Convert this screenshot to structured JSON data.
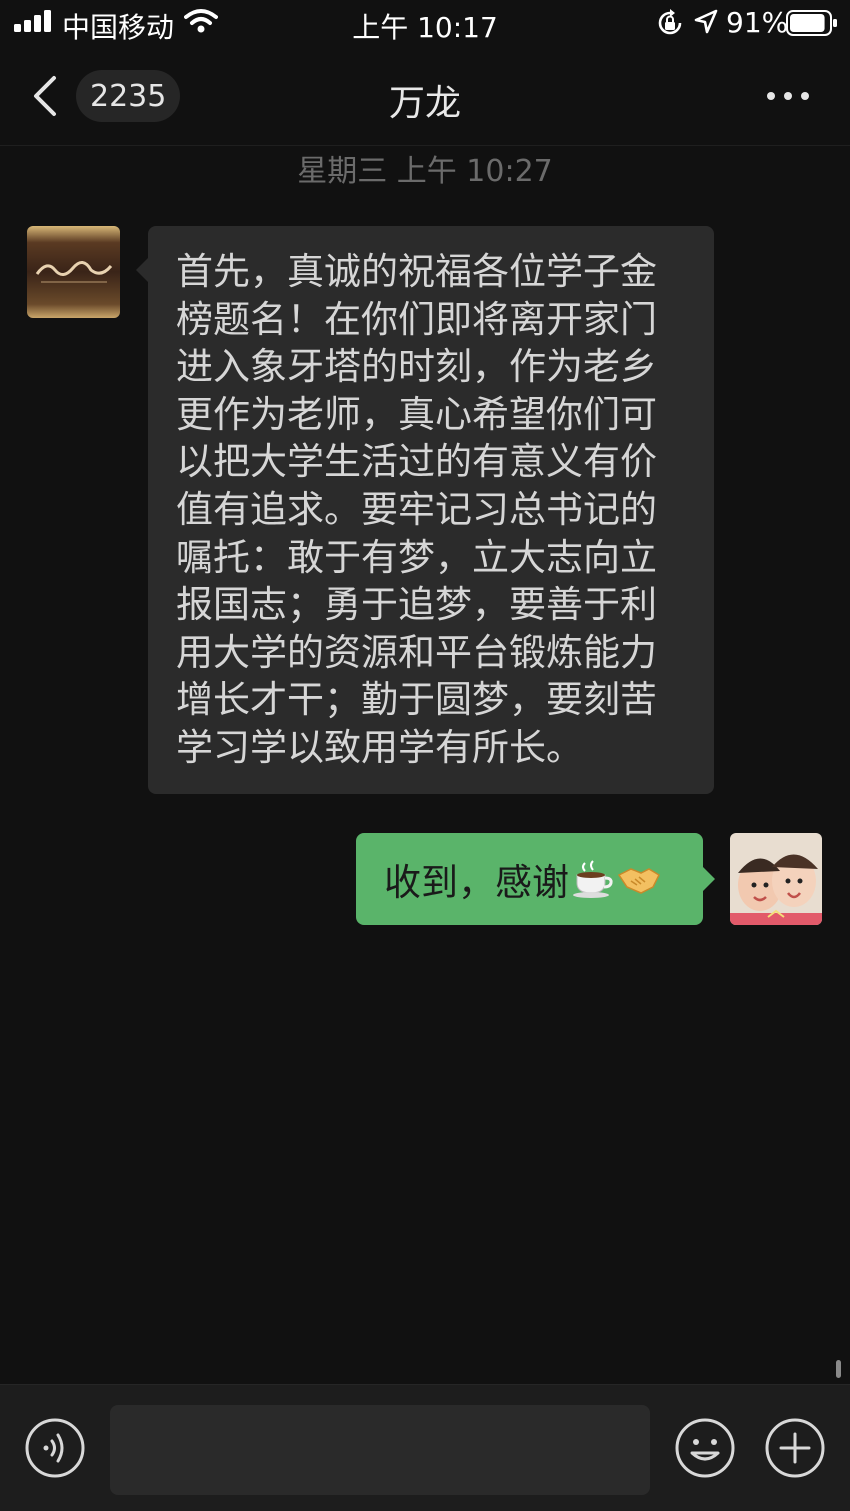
{
  "status_bar": {
    "carrier": "中国移动",
    "time": "上午 10:17",
    "battery": "91%",
    "battery_level": 0.91
  },
  "nav": {
    "unread_count": "2235",
    "title": "万龙"
  },
  "chat": {
    "timestamp": "星期三 上午 10:27",
    "messages": [
      {
        "side": "left",
        "text": "首先，真诚的祝福各位学子金榜题名！在你们即将离开家门进入象牙塔的时刻，作为老乡更作为老师，真心希望你们可以把大学生活过的有意义有价值有追求。要牢记习总书记的嘱托：敢于有梦，立大志向立报国志；勇于追梦，要善于利用大学的资源和平台锻炼能力增长才干；勤于圆梦，要刻苦学习学以致用学有所长。"
      },
      {
        "side": "right",
        "text": "收到，感谢",
        "emojis": [
          "coffee-icon",
          "handshake-icon"
        ]
      }
    ]
  },
  "input": {
    "value": "",
    "placeholder": ""
  },
  "colors": {
    "background": "#111111",
    "incoming_bubble": "#2b2b2b",
    "outgoing_bubble": "#5ab46a"
  }
}
